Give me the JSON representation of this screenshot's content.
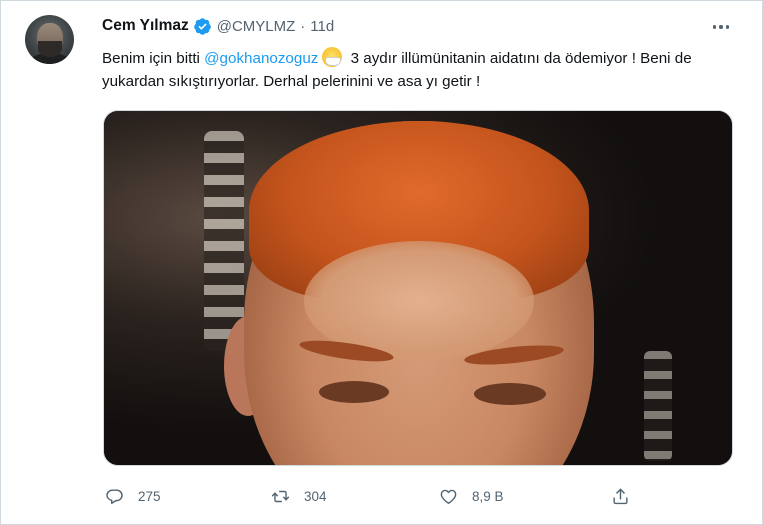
{
  "tweet": {
    "author_name": "Cem Yılmaz",
    "handle": "@CMYLMZ",
    "separator": "·",
    "time": "11d",
    "text_part1": "Benim için bitti ",
    "mention": "@gokhanozoguz",
    "text_part2": " 3 aydır illümünitanin aidatını da ödemiyor ! Beni de yukardan sıkıştırıyorlar. Derhal pelerinini ve asa yı getir !",
    "emoji": "face-with-medical-mask",
    "verified": true
  },
  "actions": {
    "reply_count": "275",
    "retweet_count": "304",
    "like_count": "8,9 B"
  },
  "colors": {
    "accent": "#1d9bf0",
    "secondary_text": "#536471",
    "primary_text": "#0f1419"
  }
}
